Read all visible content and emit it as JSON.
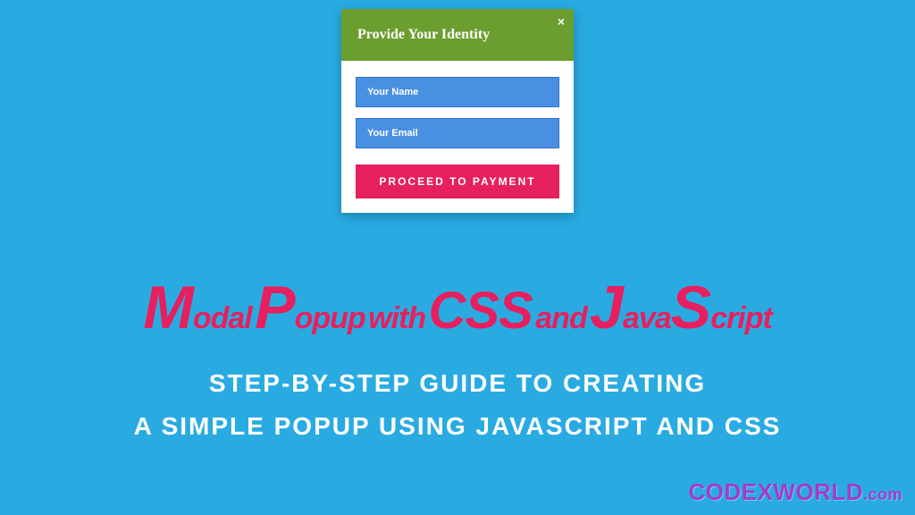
{
  "modal": {
    "title": "Provide Your Identity",
    "close": "×",
    "name_placeholder": "Your Name",
    "email_placeholder": "Your Email",
    "button": "PROCEED TO PAYMENT"
  },
  "headline": {
    "text": "Modal Popup with CSS and JavaScript"
  },
  "subheadline": {
    "line1": "STEP-BY-STEP GUIDE TO CREATING",
    "line2": "A SIMPLE POPUP USING JAVASCRIPT AND CSS"
  },
  "logo": {
    "brand": "CODEXWORLD",
    "suffix": ".com"
  },
  "colors": {
    "background": "#29abe2",
    "modal_header": "#6b9e2f",
    "input": "#4a90e2",
    "button": "#e6205f",
    "headline": "#e6205f",
    "logo": "#a43bc9"
  }
}
